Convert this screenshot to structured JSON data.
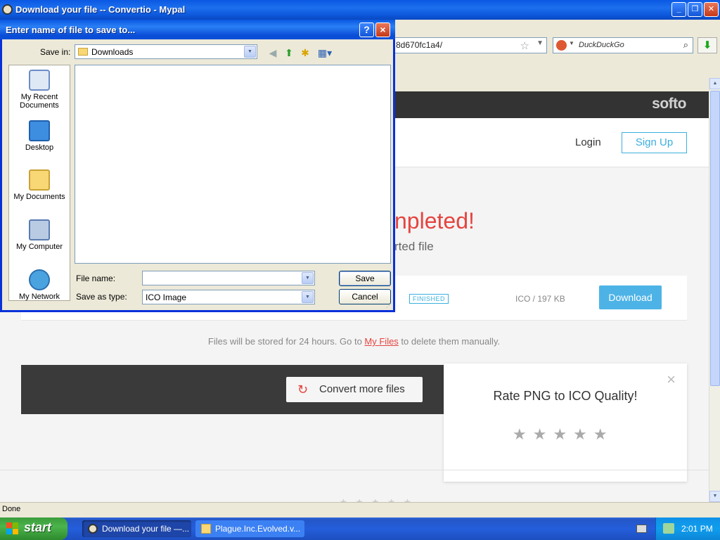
{
  "browser": {
    "title": "Download your file -- Convertio - Mypal",
    "url_fragment": "8d670fc1a4/",
    "search_engine": "DuckDuckGo",
    "status": "Done"
  },
  "site": {
    "brand": "softo",
    "login_label": "Login",
    "signup_label": "Sign Up",
    "headline_partial": "npleted!",
    "subline_partial": "rted file",
    "file": {
      "status": "FINISHED",
      "meta": "ICO / 197 KB",
      "download_label": "Download"
    },
    "storage_note": {
      "before": "Files will be stored for 24 hours. Go to ",
      "link": "My Files",
      "after": " to delete them manually."
    },
    "convert_more_label": "Convert more files",
    "rating": {
      "title": "Rate PNG to ICO Quality!",
      "stars": "★★★★★",
      "close": "×"
    }
  },
  "dialog": {
    "title": "Enter name of file to save to...",
    "help": "?",
    "close": "×",
    "save_in_label": "Save in:",
    "save_in_value": "Downloads",
    "places": [
      {
        "line1": "My Recent",
        "line2": "Documents"
      },
      {
        "line1": "Desktop",
        "line2": ""
      },
      {
        "line1": "My Documents",
        "line2": ""
      },
      {
        "line1": "My Computer",
        "line2": ""
      },
      {
        "line1": "My Network",
        "line2": ""
      }
    ],
    "file_name_label": "File name:",
    "file_name_value": "",
    "save_as_type_label": "Save as type:",
    "save_as_type_value": "ICO Image",
    "save_label": "Save",
    "cancel_label": "Cancel"
  },
  "taskbar": {
    "start_label": "start",
    "tasks": [
      {
        "label": "Download your file —..."
      },
      {
        "label": "Plague.Inc.Evolved.v..."
      }
    ],
    "clock": "2:01 PM"
  }
}
